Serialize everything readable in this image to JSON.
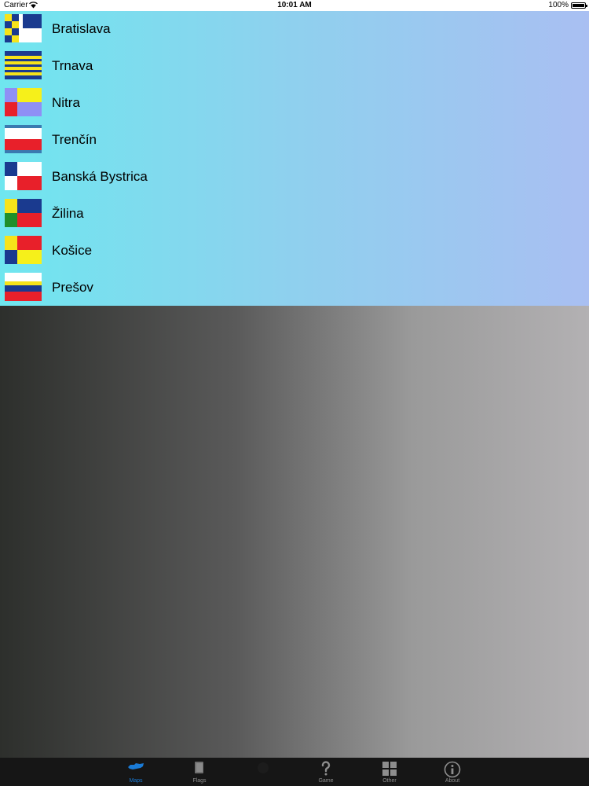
{
  "status_bar": {
    "carrier": "Carrier",
    "time": "10:01 AM",
    "battery": "100%"
  },
  "regions": [
    {
      "name": "Bratislava",
      "flag_icon": "bratislava-flag-icon"
    },
    {
      "name": "Trnava",
      "flag_icon": "trnava-flag-icon"
    },
    {
      "name": "Nitra",
      "flag_icon": "nitra-flag-icon"
    },
    {
      "name": "Trenčín",
      "flag_icon": "trencin-flag-icon"
    },
    {
      "name": "Banská Bystrica",
      "flag_icon": "banska-bystrica-flag-icon"
    },
    {
      "name": "Žilina",
      "flag_icon": "zilina-flag-icon"
    },
    {
      "name": "Košice",
      "flag_icon": "kosice-flag-icon"
    },
    {
      "name": "Prešov",
      "flag_icon": "presov-flag-icon"
    }
  ],
  "tabs": [
    {
      "label": "Maps",
      "icon": "map-icon",
      "active": true
    },
    {
      "label": "Flags",
      "icon": "book-icon",
      "active": false
    },
    {
      "label": "",
      "icon": "hidden-icon",
      "active": false
    },
    {
      "label": "Game",
      "icon": "question-icon",
      "active": false
    },
    {
      "label": "Other",
      "icon": "grid-icon",
      "active": false
    },
    {
      "label": "About",
      "icon": "info-icon",
      "active": false
    }
  ],
  "colors": {
    "accent": "#1a7bd6",
    "list_gradient_start": "#6fe6ef",
    "list_gradient_end": "#a9bff2",
    "tab_bar": "#161616"
  }
}
